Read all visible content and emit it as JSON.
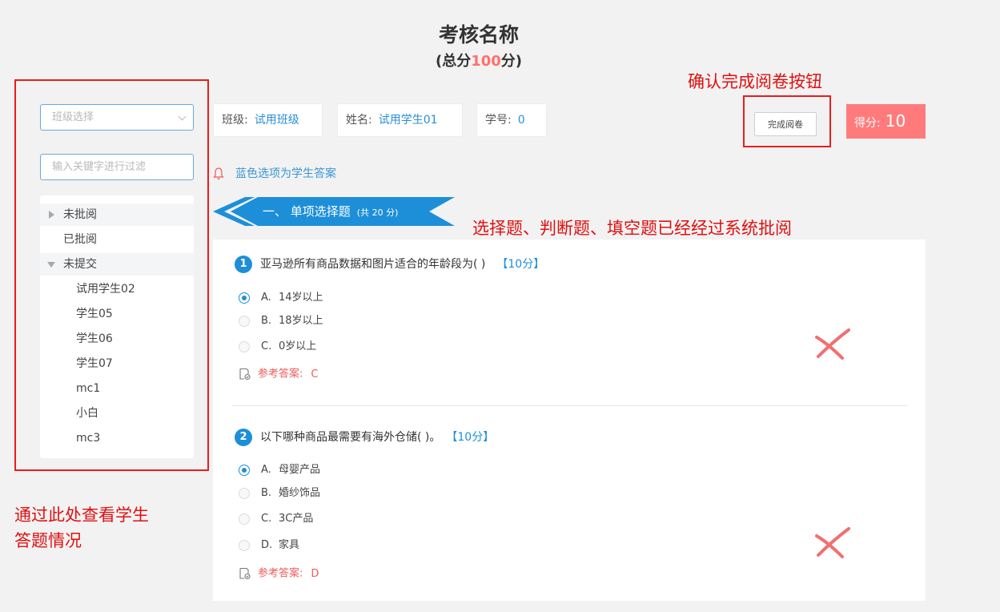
{
  "header": {
    "title": "考核名称",
    "subtitle_prefix": "(总分",
    "subtitle_score": "100",
    "subtitle_suffix": "分)"
  },
  "annotations": {
    "finish_button_note": "确认完成阅卷按钮",
    "auto_graded_note": "选择题、判断题、填空题已经经过系统批阅",
    "sidebar_note_line1": "通过此处查看学生",
    "sidebar_note_line2": "答题情况"
  },
  "sidebar": {
    "class_select_placeholder": "班级选择",
    "filter_placeholder": "输入关键字进行过滤",
    "tree": {
      "not_reviewed": "未批阅",
      "reviewed": "已批阅",
      "not_submitted": "未提交",
      "students": [
        "试用学生02",
        "学生05",
        "学生06",
        "学生07",
        "mc1",
        "小白",
        "mc3"
      ]
    }
  },
  "info": {
    "class_label": "班级:",
    "class_value": "试用班级",
    "name_label": "姓名:",
    "name_value": "试用学生01",
    "id_label": "学号:",
    "id_value": "0",
    "finish_button": "完成阅卷",
    "score_label": "得分:",
    "score_value": "10"
  },
  "hint": "蓝色选项为学生答案",
  "section": {
    "title": "一、 单项选择题",
    "points": "(共 20 分)"
  },
  "questions": [
    {
      "number": "1",
      "text": "亚马逊所有商品数据和图片适合的年龄段为(    )",
      "score": "【10分】",
      "options": [
        {
          "letter": "A.",
          "text": "14岁以上",
          "selected": true
        },
        {
          "letter": "B.",
          "text": "18岁以上",
          "selected": false
        },
        {
          "letter": "C.",
          "text": "0岁以上",
          "selected": false
        }
      ],
      "ref_label": "参考答案:",
      "ref_value": "C"
    },
    {
      "number": "2",
      "text": "以下哪种商品最需要有海外仓储(    )。",
      "score": "【10分】",
      "options": [
        {
          "letter": "A.",
          "text": "母婴产品",
          "selected": true
        },
        {
          "letter": "B.",
          "text": "婚纱饰品",
          "selected": false
        },
        {
          "letter": "C.",
          "text": "3C产品",
          "selected": false
        },
        {
          "letter": "D.",
          "text": "家具",
          "selected": false
        }
      ],
      "ref_label": "参考答案:",
      "ref_value": "D"
    }
  ],
  "colors": {
    "accent_blue": "#1d8fd8",
    "annotation_red": "#e01010",
    "score_red": "#ff7b7b",
    "ref_red": "#ef5b5b"
  }
}
